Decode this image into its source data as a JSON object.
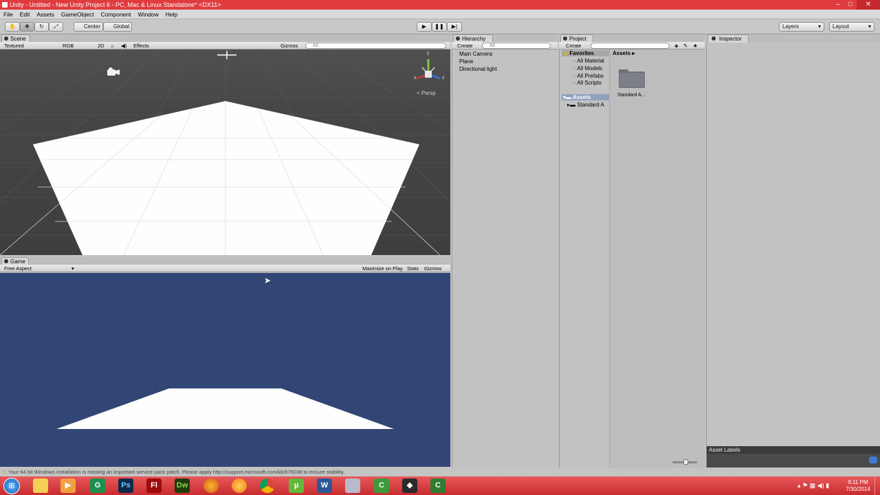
{
  "window": {
    "title": "Unity - Untitled - New Unity Project 6 - PC, Mac & Linux Standalone* <DX11>",
    "min_glyph": "–",
    "max_glyph": "□",
    "close_glyph": "✕"
  },
  "menu": [
    "File",
    "Edit",
    "Assets",
    "GameObject",
    "Component",
    "Window",
    "Help"
  ],
  "toolbar": {
    "pivot_label": "Center",
    "space_label": "Global",
    "layers_label": "Layers",
    "layout_label": "Layout"
  },
  "scene": {
    "tab": "Scene",
    "shading": "Textured",
    "render_mode": "RGB",
    "mode_2d": "2D",
    "effects": "Effects",
    "gizmos": "Gizmos",
    "search_placeholder": "All",
    "persp_label": "Persp",
    "axis_x": "x",
    "axis_y": "y",
    "axis_z": "z"
  },
  "game": {
    "tab": "Game",
    "aspect": "Free Aspect",
    "maximize": "Maximize on Play",
    "stats": "Stats",
    "gizmos": "Gizmos"
  },
  "hierarchy": {
    "tab": "Hierarchy",
    "create": "Create",
    "search_placeholder": "All",
    "items": [
      "Main Camera",
      "Plane",
      "Directional light"
    ]
  },
  "project": {
    "tab": "Project",
    "create": "Create",
    "favorites_label": "Favorites",
    "favorites": [
      "All Material",
      "All Models",
      "All Prefabs",
      "All Scripts"
    ],
    "assets_label": "Assets",
    "assets_children": [
      "Standard A"
    ],
    "breadcrumb": "Assets",
    "grid_items": [
      {
        "label": "Standard A..."
      }
    ]
  },
  "inspector": {
    "tab": "Inspector",
    "asset_labels": "Asset Labels"
  },
  "status": {
    "message": "Your 64 bit Windows installation is missing an important service pack patch. Please apply http://support.microsoft.com/kb/976038 to ensure stability."
  },
  "taskbar": {
    "apps": [
      {
        "icon": "folder-icon",
        "glyph": ""
      },
      {
        "icon": "media-player-icon",
        "glyph": "▶"
      },
      {
        "icon": "app-g-icon",
        "glyph": "G"
      },
      {
        "icon": "photoshop-icon",
        "glyph": "Ps"
      },
      {
        "icon": "flash-icon",
        "glyph": "Fl"
      },
      {
        "icon": "dreamweaver-icon",
        "glyph": "Dw"
      },
      {
        "icon": "firefox-icon",
        "glyph": ""
      },
      {
        "icon": "orange-app-icon",
        "glyph": ""
      },
      {
        "icon": "chrome-icon",
        "glyph": ""
      },
      {
        "icon": "utorrent-icon",
        "glyph": "µ"
      },
      {
        "icon": "word-icon",
        "glyph": "W"
      },
      {
        "icon": "network-app-icon",
        "glyph": ""
      },
      {
        "icon": "camtasia-icon",
        "glyph": "C"
      },
      {
        "icon": "unity-icon",
        "glyph": "◆"
      },
      {
        "icon": "camtasia-recorder-icon",
        "glyph": "C"
      }
    ],
    "time": "9:11 PM",
    "date": "7/30/2014"
  },
  "colors": {
    "titlebar": "#e03c3f",
    "taskbar": "#d03537",
    "game_background": "#314674",
    "scene_background": "#464646"
  }
}
